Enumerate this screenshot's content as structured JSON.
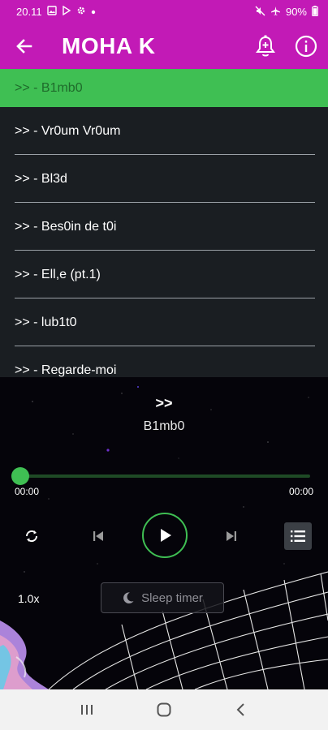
{
  "status_bar": {
    "time": "20.11",
    "battery": "90%",
    "left_icons": [
      "image-icon",
      "play-store-icon",
      "settings-icon",
      "dot-icon"
    ],
    "right_icons": [
      "mute-icon",
      "airplane-icon",
      "battery-icon"
    ]
  },
  "app_bar": {
    "title": "MOHA K",
    "color": "#c21ab6"
  },
  "tracks": [
    {
      "label": ">> - B1mb0",
      "active": true
    },
    {
      "label": ">> - Vr0um Vr0um",
      "active": false
    },
    {
      "label": ">> - Bl3d",
      "active": false
    },
    {
      "label": ">> - Bes0in de t0i",
      "active": false
    },
    {
      "label": ">> - Ell,e (pt.1)",
      "active": false
    },
    {
      "label": ">> - lub1t0",
      "active": false
    },
    {
      "label": ">> - Regarde-moi",
      "active": false
    }
  ],
  "player": {
    "artist": ">>",
    "title": "B1mb0",
    "time_current": "00:00",
    "time_total": "00:00",
    "progress": 0.0,
    "speed": "1.0x",
    "sleep_timer": "Sleep timer",
    "accent": "#3fbf53"
  }
}
